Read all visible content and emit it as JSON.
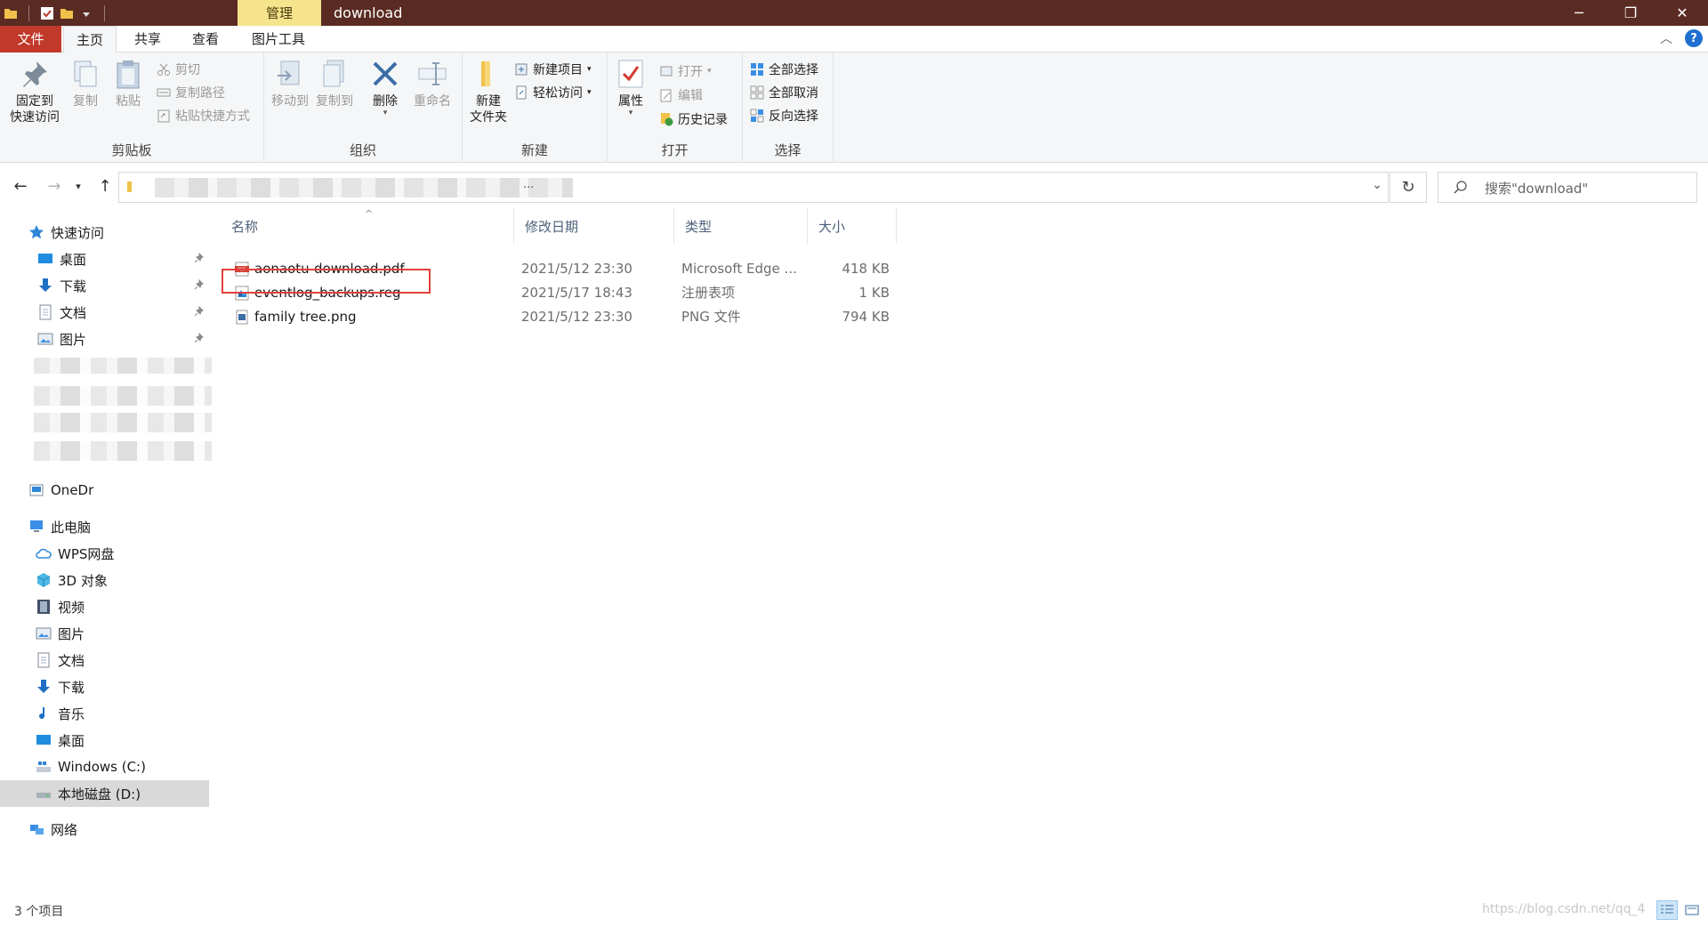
{
  "window": {
    "context_tab": "管理",
    "title": "download",
    "minimize": "─",
    "restore": "❐",
    "close": "✕"
  },
  "ribbon_tabs": {
    "file": "文件",
    "home": "主页",
    "share": "共享",
    "view": "查看",
    "picture_tools": "图片工具"
  },
  "ribbon": {
    "clipboard": {
      "label": "剪贴板",
      "pin": "固定到\n快速访问",
      "copy": "复制",
      "paste": "粘贴",
      "cut": "剪切",
      "copy_path": "复制路径",
      "paste_shortcut": "粘贴快捷方式"
    },
    "organize": {
      "label": "组织",
      "move_to": "移动到",
      "copy_to": "复制到",
      "delete": "删除",
      "rename": "重命名"
    },
    "new": {
      "label": "新建",
      "new_folder": "新建\n文件夹",
      "new_item": "新建项目",
      "easy_access": "轻松访问"
    },
    "open": {
      "label": "打开",
      "properties": "属性",
      "open": "打开",
      "edit": "编辑",
      "history": "历史记录"
    },
    "select": {
      "label": "选择",
      "select_all": "全部选择",
      "select_none": "全部取消",
      "invert": "反向选择"
    }
  },
  "address": {
    "ellipsis": "...",
    "search_placeholder": "搜索\"download\""
  },
  "sidebar": {
    "quick_access": "快速访问",
    "quick_items": [
      {
        "label": "桌面"
      },
      {
        "label": "下载"
      },
      {
        "label": "文档"
      },
      {
        "label": "图片"
      }
    ],
    "onedrive": "OneDr",
    "this_pc": "此电脑",
    "pc_items": [
      {
        "label": "WPS网盘"
      },
      {
        "label": "3D 对象"
      },
      {
        "label": "视频"
      },
      {
        "label": "图片"
      },
      {
        "label": "文档"
      },
      {
        "label": "下载"
      },
      {
        "label": "音乐"
      },
      {
        "label": "桌面"
      },
      {
        "label": "Windows (C:)"
      },
      {
        "label": "本地磁盘 (D:)"
      }
    ],
    "network": "网络"
  },
  "columns": {
    "name": "名称",
    "modified": "修改日期",
    "type": "类型",
    "size": "大小"
  },
  "files": [
    {
      "name": "aonaotu-download.pdf",
      "modified": "2021/5/12 23:30",
      "type": "Microsoft Edge ...",
      "size": "418 KB",
      "icon": "pdf-icon"
    },
    {
      "name": "eventlog_backups.reg",
      "modified": "2021/5/17 18:43",
      "type": "注册表项",
      "size": "1 KB",
      "icon": "registry-icon"
    },
    {
      "name": "family tree.png",
      "modified": "2021/5/12 23:30",
      "type": "PNG 文件",
      "size": "794 KB",
      "icon": "image-file-icon"
    }
  ],
  "status": {
    "item_count": "3 个项目",
    "watermark": "https://blog.csdn.net/qq_4"
  }
}
